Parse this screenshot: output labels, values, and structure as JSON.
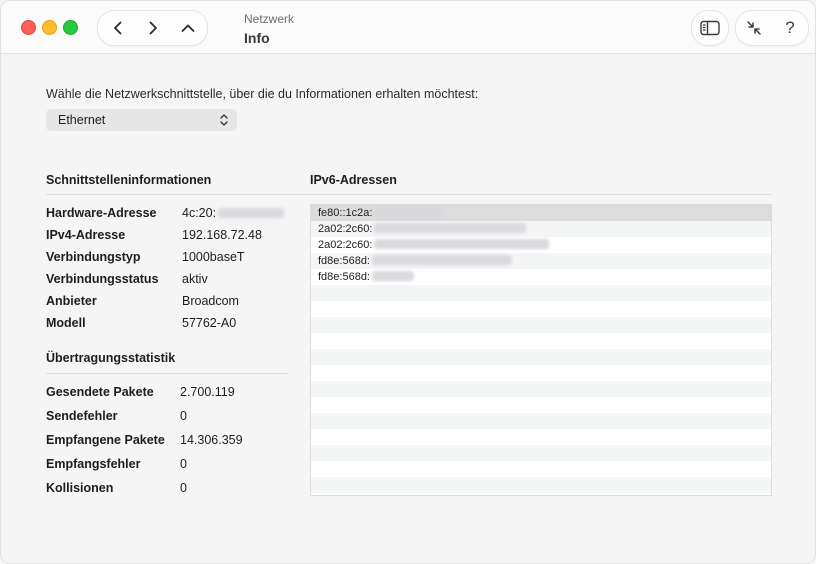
{
  "window": {
    "subtitle": "Netzwerk",
    "title": "Info"
  },
  "toolbar": {
    "icons": [
      "chevron-left-icon",
      "chevron-right-icon",
      "chevron-up-icon",
      "sidebar-icon",
      "collapse-arrows-icon",
      "help-icon"
    ],
    "help_label": "?"
  },
  "interface": {
    "prompt": "Wähle die Netzwerkschnittstelle, über die du Informationen erhalten möchtest:",
    "selected": "Ethernet"
  },
  "interface_info": {
    "heading": "Schnittstelleninformationen",
    "rows": [
      {
        "label": "Hardware-Adresse",
        "value": "4c:20:"
      },
      {
        "label": "IPv4-Adresse",
        "value": "192.168.72.48"
      },
      {
        "label": "Verbindungstyp",
        "value": "1000baseT"
      },
      {
        "label": "Verbindungsstatus",
        "value": "aktiv"
      },
      {
        "label": "Anbieter",
        "value": "Broadcom"
      },
      {
        "label": "Modell",
        "value": "57762-A0"
      }
    ]
  },
  "transfer_stats": {
    "heading": "Übertragungsstatistik",
    "rows": [
      {
        "label": "Gesendete Pakete",
        "value": "2.700.119"
      },
      {
        "label": "Sendefehler",
        "value": "0"
      },
      {
        "label": "Empfangene Pakete",
        "value": "14.306.359"
      },
      {
        "label": "Empfangsfehler",
        "value": "0"
      },
      {
        "label": "Kollisionen",
        "value": "0"
      }
    ]
  },
  "ipv6": {
    "heading": "IPv6-Adressen",
    "addresses": [
      "fe80::1c2a:",
      "2a02:2c60:",
      "2a02:2c60:",
      "fd8e:568d:",
      "fd8e:568d:"
    ]
  }
}
